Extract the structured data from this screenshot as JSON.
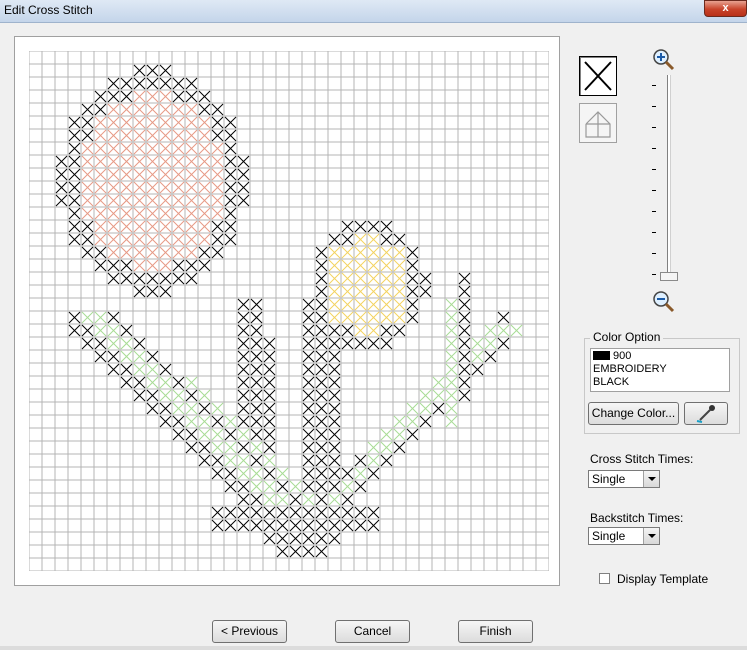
{
  "window": {
    "title": "Edit Cross Stitch",
    "close_glyph": "x"
  },
  "tools": [
    {
      "name": "cross-stitch-tool",
      "icon": "cross-stitch-icon",
      "selected": true
    },
    {
      "name": "backstitch-tool",
      "icon": "backstitch-icon",
      "selected": false
    }
  ],
  "zoom": {
    "in_icon": "zoom-in-icon",
    "out_icon": "zoom-out-icon",
    "level_fraction": 0.0
  },
  "color_option": {
    "label": "Color Option",
    "selected": {
      "code": "900",
      "line2": "EMBROIDERY",
      "line3": "BLACK",
      "swatch": "#000000"
    },
    "change_button": "Change Color...",
    "eyedropper_icon": "eyedropper-icon"
  },
  "cross_stitch_times": {
    "label": "Cross Stitch Times:",
    "value": "Single"
  },
  "backstitch_times": {
    "label": "Backstitch Times:",
    "value": "Single"
  },
  "display_template": {
    "label": "Display Template",
    "checked": false
  },
  "footer": {
    "previous": "< Previous",
    "cancel": "Cancel",
    "finish": "Finish"
  },
  "colors": {
    "black": "#000000",
    "salmon": "#e69985",
    "yellow": "#f3d25f",
    "green": "#a8dc95",
    "grid": "#b4b4b4"
  }
}
